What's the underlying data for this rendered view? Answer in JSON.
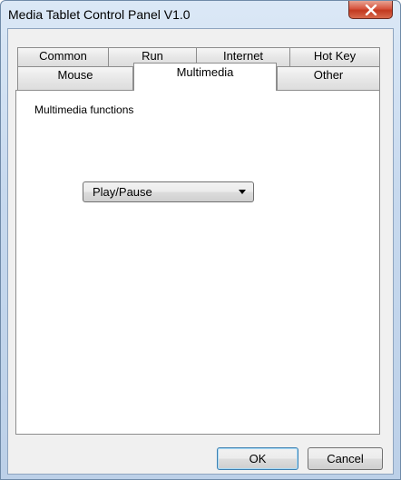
{
  "window": {
    "title": "Media Tablet Control Panel V1.0"
  },
  "tabs_row1": [
    {
      "label": "Common"
    },
    {
      "label": "Run"
    },
    {
      "label": "Internet"
    },
    {
      "label": "Hot Key"
    }
  ],
  "tabs_row2": [
    {
      "label": "Mouse"
    },
    {
      "label": "Multimedia",
      "active": true
    },
    {
      "label": "Other"
    }
  ],
  "panel": {
    "label": "Multimedia functions",
    "combo_value": "Play/Pause"
  },
  "buttons": {
    "ok": "OK",
    "cancel": "Cancel"
  },
  "colors": {
    "close_button": "#d7553f",
    "window_frame": "#c7d9ee"
  }
}
